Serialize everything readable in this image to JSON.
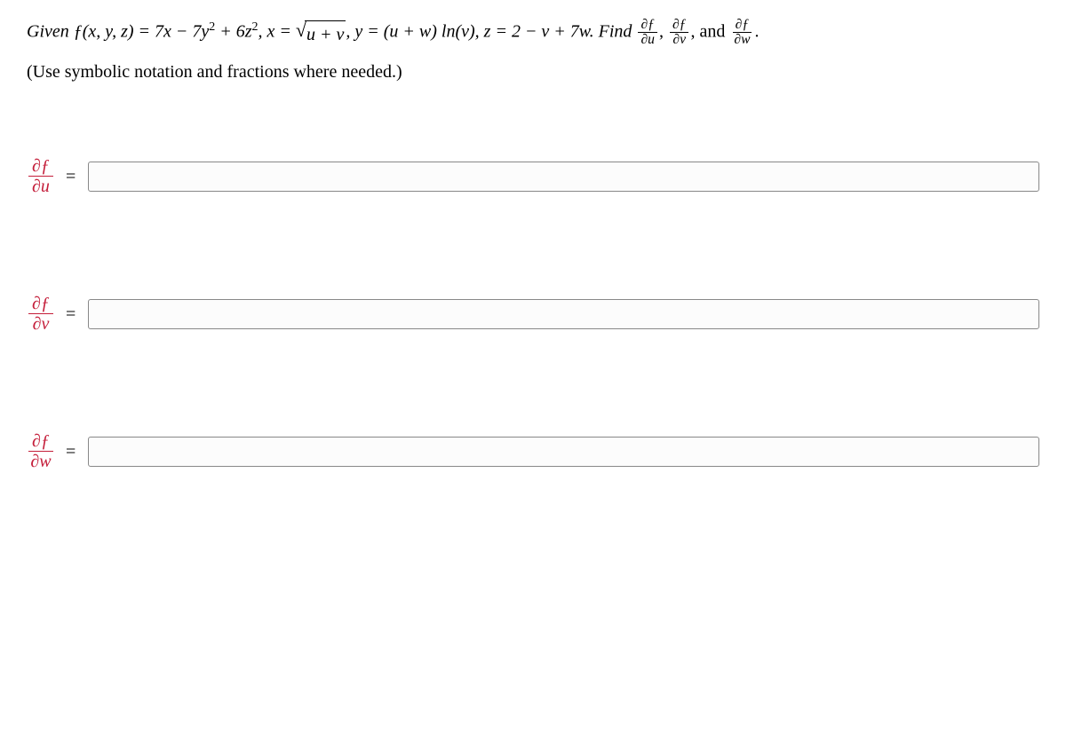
{
  "problem": {
    "text_before_sqrt": "Given ƒ(x, y, z) = 7x − 7y",
    "y_exp": "2",
    "after_y": " + 6z",
    "z_exp": "2",
    "after_z": ", x = ",
    "sqrt_arg": "u + v",
    "after_sqrt": ", y = (u + w) ln(v), z = 2 − v + 7w. Find ",
    "d1_num": "∂ƒ",
    "d1_den": "∂u",
    "sep1": ", ",
    "d2_num": "∂ƒ",
    "d2_den": "∂v",
    "sep2": ", and ",
    "d3_num": "∂ƒ",
    "d3_den": "∂w",
    "period": "."
  },
  "hint": "(Use symbolic notation and fractions where needed.)",
  "answers": [
    {
      "num": "∂ƒ",
      "den": "∂u",
      "value": ""
    },
    {
      "num": "∂ƒ",
      "den": "∂v",
      "value": ""
    },
    {
      "num": "∂ƒ",
      "den": "∂w",
      "value": ""
    }
  ]
}
